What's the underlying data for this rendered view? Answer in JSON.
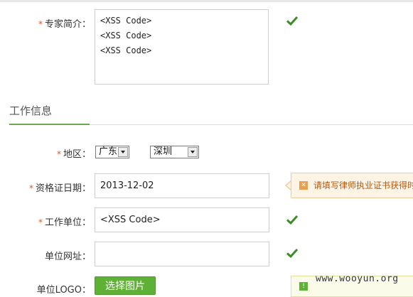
{
  "form": {
    "expert_intro": {
      "label": "专家简介：",
      "required_mark": "*",
      "lines": [
        "<XSS Code>",
        "<XSS Code>",
        "<XSS Code>"
      ]
    },
    "section_title": "工作信息",
    "region": {
      "label": "地区：",
      "required_mark": "*",
      "province": "广东",
      "city": "深圳"
    },
    "license_date": {
      "label": "资格证日期：",
      "required_mark": "*",
      "value": "2013-12-02",
      "tip": "请填写律师执业证书获得时"
    },
    "work_unit": {
      "label": "工作单位：",
      "required_mark": "*",
      "value": "<XSS Code>"
    },
    "unit_url": {
      "label": "单位网址：",
      "value": ""
    },
    "unit_logo": {
      "label": "单位LOGO：",
      "button_label": "选择图片"
    }
  },
  "icons": {
    "valid": "check-icon",
    "warning": "warning-icon",
    "info": "info-icon"
  },
  "colors": {
    "required": "#e5531a",
    "valid": "#3d8b2a",
    "accent": "#6aa84f",
    "button": "#5fb136",
    "tip_bg": "#fdf4e6",
    "tip_text": "#b35a16"
  },
  "watermark": "www.wooyun.org"
}
